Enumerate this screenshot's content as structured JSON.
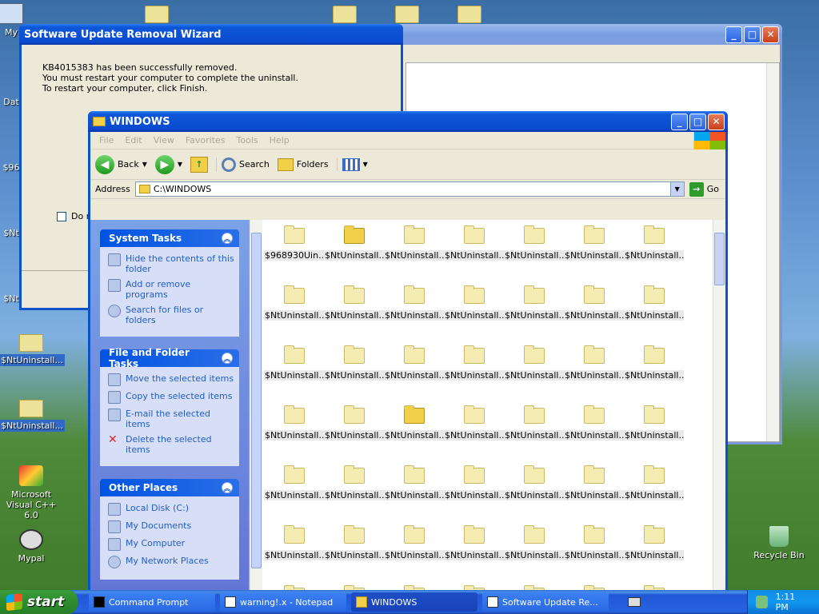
{
  "desktop": {
    "icons": [
      {
        "label": "My",
        "sel": false
      },
      {
        "label": "Dat",
        "sel": false
      },
      {
        "label": "$96",
        "sel": false
      },
      {
        "label": "$Nt",
        "sel": false
      },
      {
        "label": "$Nt",
        "sel": false
      },
      {
        "label": "$NtUninstall...",
        "sel": true
      },
      {
        "label": "$NtUninstall...",
        "sel": true
      },
      {
        "label": "Microsoft Visual C++ 6.0",
        "sel": false
      },
      {
        "label": "Mypal",
        "sel": false
      },
      {
        "label": "Recycle Bin",
        "sel": false
      }
    ]
  },
  "wizard": {
    "title": "Software Update Removal Wizard",
    "line1": "KB4015383 has been successfully removed.",
    "line2": "You must restart your computer to complete the uninstall.",
    "line3": "To restart your computer, click Finish.",
    "checkbox_label": "Do n"
  },
  "explorer": {
    "title": "WINDOWS",
    "menu": [
      "File",
      "Edit",
      "View",
      "Favorites",
      "Tools",
      "Help"
    ],
    "toolbar": {
      "back": "Back",
      "search": "Search",
      "folders": "Folders"
    },
    "address_label": "Address",
    "address_value": "C:\\WINDOWS",
    "go_label": "Go",
    "system_tasks": {
      "title": "System Tasks",
      "items": [
        "Hide the contents of this folder",
        "Add or remove programs",
        "Search for files or folders"
      ]
    },
    "file_tasks": {
      "title": "File and Folder Tasks",
      "items": [
        "Move the selected items",
        "Copy the selected items",
        "E-mail the selected items",
        "Delete the selected items"
      ]
    },
    "other_places": {
      "title": "Other Places",
      "items": [
        "Local Disk (C:)",
        "My Documents",
        "My Computer",
        "My Network Places"
      ]
    },
    "files": [
      "$968930Uin...",
      "$NtUninstall...",
      "$NtUninstall...",
      "$NtUninstall...",
      "$NtUninstall...",
      "$NtUninstall...",
      "$NtUninstall...",
      "$NtUninstall...",
      "$NtUninstall...",
      "$NtUninstall...",
      "$NtUninstall...",
      "$NtUninstall...",
      "$NtUninstall...",
      "$NtUninstall...",
      "$NtUninstall...",
      "$NtUninstall...",
      "$NtUninstall...",
      "$NtUninstall...",
      "$NtUninstall...",
      "$NtUninstall...",
      "$NtUninstall...",
      "$NtUninstall...",
      "$NtUninstall...",
      "$NtUninstall...",
      "$NtUninstall...",
      "$NtUninstall...",
      "$NtUninstall...",
      "$NtUninstall...",
      "$NtUninstall...",
      "$NtUninstall...",
      "$NtUninstall...",
      "$NtUninstall...",
      "$NtUninstall...",
      "$NtUninstall...",
      "$NtUninstall...",
      "$NtUninstall...",
      "$NtUninstall...",
      "$NtUninstall...",
      "$NtUninstall...",
      "$NtUninstall...",
      "$NtUninstall...",
      "$NtUninstall...",
      "",
      "",
      "",
      "",
      "",
      "",
      ""
    ],
    "open_folders": [
      1,
      23
    ]
  },
  "taskbar": {
    "start": "start",
    "tasks": [
      {
        "label": "Command Prompt",
        "active": false
      },
      {
        "label": "warning!.x - Notepad",
        "active": false
      },
      {
        "label": "WINDOWS",
        "active": true
      },
      {
        "label": "Software Update Re...",
        "active": false
      }
    ],
    "clock": "1:11 PM"
  }
}
